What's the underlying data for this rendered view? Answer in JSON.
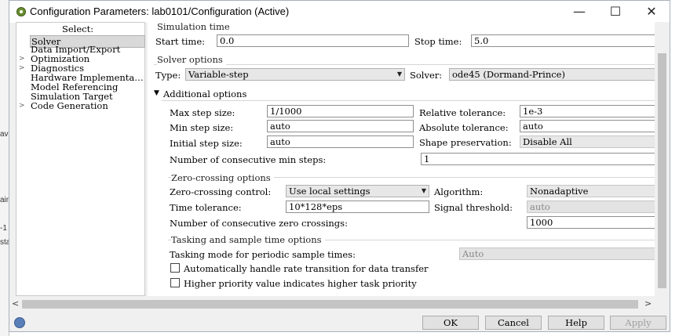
{
  "window": {
    "title": "Configuration Parameters: lab0101/Configuration (Active)",
    "minimize": "—",
    "maximize": "☐",
    "close": "✕"
  },
  "background": {
    "frag1": "ave",
    "frag2": "ain",
    "frag3": "-1",
    "frag4": "sta"
  },
  "tree": {
    "header": "Select:",
    "items": [
      {
        "label": "Solver",
        "expandable": false,
        "selected": true
      },
      {
        "label": "Data Import/Export",
        "expandable": false
      },
      {
        "label": "Optimization",
        "expandable": true
      },
      {
        "label": "Diagnostics",
        "expandable": true
      },
      {
        "label": "Hardware Implementa…",
        "expandable": false
      },
      {
        "label": "Model Referencing",
        "expandable": false
      },
      {
        "label": "Simulation Target",
        "expandable": false
      },
      {
        "label": "Code Generation",
        "expandable": true
      }
    ],
    "expander": ">"
  },
  "sim_time": {
    "group": "Simulation time",
    "start_label": "Start time:",
    "start_value": "0.0",
    "stop_label": "Stop time:",
    "stop_value": "5.0"
  },
  "solver_options": {
    "group": "Solver options",
    "type_label": "Type:",
    "type_value": "Variable-step",
    "solver_label": "Solver:",
    "solver_value": "ode45 (Dormand-Prince)"
  },
  "additional": {
    "toggle": "▼",
    "group": "Additional options",
    "max_step_label": "Max step size:",
    "max_step_value": "1/1000",
    "rel_tol_label": "Relative tolerance:",
    "rel_tol_value": "1e-3",
    "min_step_label": "Min step size:",
    "min_step_value": "auto",
    "abs_tol_label": "Absolute tolerance:",
    "abs_tol_value": "auto",
    "init_step_label": "Initial step size:",
    "init_step_value": "auto",
    "shape_label": "Shape preservation:",
    "shape_value": "Disable All",
    "consec_min_label": "Number of consecutive min steps:",
    "consec_min_value": "1"
  },
  "zero_crossing": {
    "group": "Zero-crossing options",
    "control_label": "Zero-crossing control:",
    "control_value": "Use local settings",
    "algorithm_label": "Algorithm:",
    "algorithm_value": "Nonadaptive",
    "time_tol_label": "Time tolerance:",
    "time_tol_value": "10*128*eps",
    "signal_label": "Signal threshold:",
    "signal_value": "auto",
    "consec_zc_label": "Number of consecutive zero crossings:",
    "consec_zc_value": "1000"
  },
  "tasking": {
    "group": "Tasking and sample time options",
    "mode_label": "Tasking mode for periodic sample times:",
    "mode_value": "Auto",
    "chk1_label": "Automatically handle rate transition for data transfer",
    "chk2_label": "Higher priority value indicates higher task priority"
  },
  "scroll": {
    "left": "<",
    "right": ">"
  },
  "buttons": {
    "ok": "OK",
    "cancel": "Cancel",
    "help": "Help",
    "apply": "Apply"
  }
}
